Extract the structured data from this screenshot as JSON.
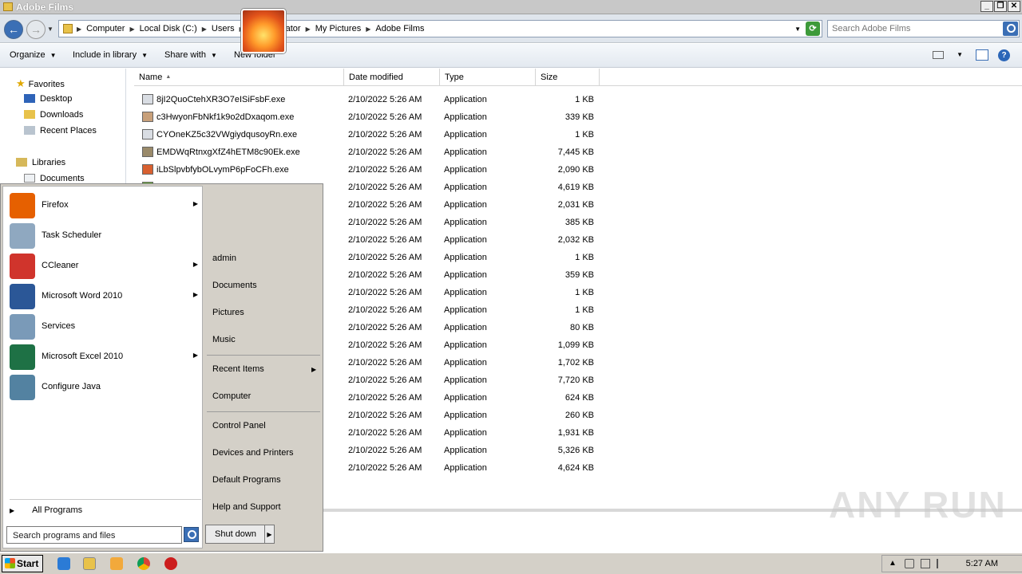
{
  "window": {
    "title": "Adobe Films"
  },
  "address": {
    "crumbs": [
      "Computer",
      "Local Disk (C:)",
      "Users",
      "Administrator",
      "My Pictures",
      "Adobe Films"
    ]
  },
  "search": {
    "placeholder": "Search Adobe Films"
  },
  "toolbar": {
    "organize": "Organize",
    "include": "Include in library",
    "share": "Share with",
    "newfolder": "New folder"
  },
  "nav": {
    "favorites": "Favorites",
    "desktop": "Desktop",
    "downloads": "Downloads",
    "recent": "Recent Places",
    "libraries": "Libraries",
    "documents": "Documents"
  },
  "columns": {
    "name": "Name",
    "date": "Date modified",
    "type": "Type",
    "size": "Size"
  },
  "files": [
    {
      "name": "8jI2QuoCtehXR3O7eISiFsbF.exe",
      "date": "2/10/2022 5:26 AM",
      "type": "Application",
      "size": "1 KB",
      "color": "#d9dde3"
    },
    {
      "name": "c3HwyonFbNkf1k9o2dDxaqom.exe",
      "date": "2/10/2022 5:26 AM",
      "type": "Application",
      "size": "339 KB",
      "color": "#c8a07a"
    },
    {
      "name": "CYOneKZ5c32VWgiydqusoyRn.exe",
      "date": "2/10/2022 5:26 AM",
      "type": "Application",
      "size": "1 KB",
      "color": "#d9dde3"
    },
    {
      "name": "EMDWqRtnxgXfZ4hETM8c90Ek.exe",
      "date": "2/10/2022 5:26 AM",
      "type": "Application",
      "size": "7,445 KB",
      "color": "#9a8a6a"
    },
    {
      "name": "iLbSlpvbfybOLvymP6pFoCFh.exe",
      "date": "2/10/2022 5:26 AM",
      "type": "Application",
      "size": "2,090 KB",
      "color": "#d86030"
    },
    {
      "name": "",
      "date": "2/10/2022 5:26 AM",
      "type": "Application",
      "size": "4,619 KB",
      "color": "#6cae3c"
    },
    {
      "name": "",
      "date": "2/10/2022 5:26 AM",
      "type": "Application",
      "size": "2,031 KB",
      "color": ""
    },
    {
      "name": "",
      "date": "2/10/2022 5:26 AM",
      "type": "Application",
      "size": "385 KB",
      "color": ""
    },
    {
      "name": "",
      "date": "2/10/2022 5:26 AM",
      "type": "Application",
      "size": "2,032 KB",
      "color": ""
    },
    {
      "name": "",
      "date": "2/10/2022 5:26 AM",
      "type": "Application",
      "size": "1 KB",
      "color": ""
    },
    {
      "name": "",
      "date": "2/10/2022 5:26 AM",
      "type": "Application",
      "size": "359 KB",
      "color": ""
    },
    {
      "name": "",
      "date": "2/10/2022 5:26 AM",
      "type": "Application",
      "size": "1 KB",
      "color": ""
    },
    {
      "name": "",
      "date": "2/10/2022 5:26 AM",
      "type": "Application",
      "size": "1 KB",
      "color": ""
    },
    {
      "name": "",
      "date": "2/10/2022 5:26 AM",
      "type": "Application",
      "size": "80 KB",
      "color": ""
    },
    {
      "name": "",
      "date": "2/10/2022 5:26 AM",
      "type": "Application",
      "size": "1,099 KB",
      "color": ""
    },
    {
      "name": "",
      "date": "2/10/2022 5:26 AM",
      "type": "Application",
      "size": "1,702 KB",
      "color": ""
    },
    {
      "name": "",
      "date": "2/10/2022 5:26 AM",
      "type": "Application",
      "size": "7,720 KB",
      "color": ""
    },
    {
      "name": "",
      "date": "2/10/2022 5:26 AM",
      "type": "Application",
      "size": "624 KB",
      "color": ""
    },
    {
      "name": "",
      "date": "2/10/2022 5:26 AM",
      "type": "Application",
      "size": "260 KB",
      "color": ""
    },
    {
      "name": "",
      "date": "2/10/2022 5:26 AM",
      "type": "Application",
      "size": "1,931 KB",
      "color": ""
    },
    {
      "name": "",
      "date": "2/10/2022 5:26 AM",
      "type": "Application",
      "size": "5,326 KB",
      "color": ""
    },
    {
      "name": "",
      "date": "2/10/2022 5:26 AM",
      "type": "Application",
      "size": "4,624 KB",
      "color": ""
    }
  ],
  "startmenu": {
    "programs": [
      {
        "label": "Firefox",
        "icon": "firefox-icon",
        "color": "#e66000",
        "submenu": true
      },
      {
        "label": "Task Scheduler",
        "icon": "clock-icon",
        "color": "#8fa8c0",
        "submenu": false
      },
      {
        "label": "CCleaner",
        "icon": "ccleaner-icon",
        "color": "#d0342c",
        "submenu": true
      },
      {
        "label": "Microsoft Word 2010",
        "icon": "word-icon",
        "color": "#2b5797",
        "submenu": true
      },
      {
        "label": "Services",
        "icon": "gears-icon",
        "color": "#7a9ab8",
        "submenu": false
      },
      {
        "label": "Microsoft Excel 2010",
        "icon": "excel-icon",
        "color": "#1e7145",
        "submenu": true
      },
      {
        "label": "Configure Java",
        "icon": "java-icon",
        "color": "#5382a1",
        "submenu": false
      }
    ],
    "all_programs": "All Programs",
    "search_placeholder": "Search programs and files",
    "right": {
      "user": "admin",
      "documents": "Documents",
      "pictures": "Pictures",
      "music": "Music",
      "recent_items": "Recent Items",
      "computer": "Computer",
      "control_panel": "Control Panel",
      "devices": "Devices and Printers",
      "defaults": "Default Programs",
      "help": "Help and Support"
    },
    "shutdown": "Shut down"
  },
  "taskbar": {
    "start": "Start",
    "clock": "5:27 AM"
  },
  "watermark": "ANY RUN"
}
